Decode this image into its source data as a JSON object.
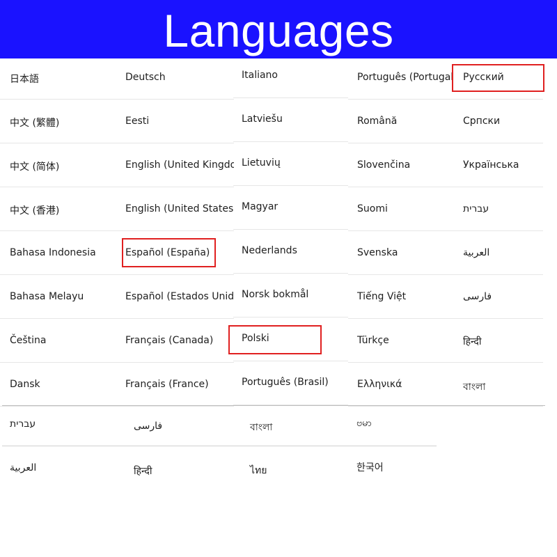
{
  "header": {
    "title": "Languages",
    "background": "#1a12ff"
  },
  "highlight_color": "#e02020",
  "columns": [
    [
      "日本語",
      "中文 (繁體)",
      "中文 (简体)",
      "中文 (香港)",
      "Bahasa Indonesia",
      "Bahasa Melayu",
      "Čeština",
      "Dansk"
    ],
    [
      "Deutsch",
      "Eesti",
      "English (United Kingdom)",
      "English (United States)",
      "Español (España)",
      "Español (Estados Unidos)",
      "Français (Canada)",
      "Français (France)"
    ],
    [
      "Italiano",
      "Latviešu",
      "Lietuvių",
      "Magyar",
      "Nederlands",
      "Norsk bokmål",
      "Polski",
      "Português (Brasil)"
    ],
    [
      "Português (Portugal)",
      "Română",
      "Slovenčina",
      "Suomi",
      "Svenska",
      "Tiếng Việt",
      "Türkçe",
      "Ελληνικά"
    ],
    [
      "Русский",
      "Српски",
      "Українська",
      "עברית",
      "العربية",
      "فارسی",
      "हिन्दी",
      "বাংলা"
    ]
  ],
  "bottom_rows": [
    [
      "עברית",
      "فارسی",
      "বাংলা",
      "ဗမာ"
    ],
    [
      "العربية",
      "हिन्दी",
      "ไทย",
      "한국어"
    ]
  ],
  "highlighted": [
    "Русский",
    "Español (España)",
    "Polski"
  ]
}
